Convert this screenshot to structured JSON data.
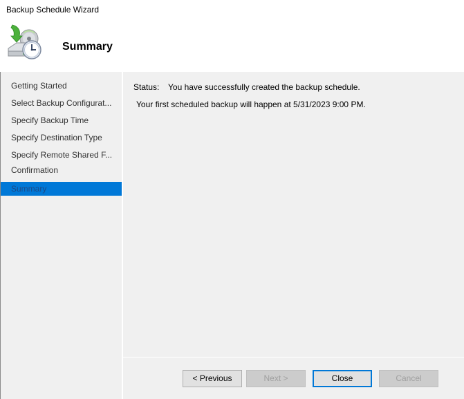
{
  "window": {
    "title": "Backup Schedule Wizard"
  },
  "header": {
    "icon": "backup-schedule-icon",
    "page_title": "Summary"
  },
  "sidebar": {
    "items": [
      {
        "label": "Getting Started",
        "selected": false
      },
      {
        "label": "Select Backup Configurat...",
        "selected": false
      },
      {
        "label": "Specify Backup Time",
        "selected": false
      },
      {
        "label": "Specify Destination Type",
        "selected": false
      },
      {
        "label": "Specify Remote Shared F...",
        "selected": false
      },
      {
        "label": "Confirmation",
        "selected": false
      },
      {
        "label": "Summary",
        "selected": true
      }
    ]
  },
  "main": {
    "status_label": "Status:",
    "status_text": "You have successfully created the backup schedule.",
    "detail_text": "Your first scheduled backup will happen at 5/31/2023 9:00 PM."
  },
  "footer": {
    "previous_label": "< Previous",
    "next_label": "Next >",
    "close_label": "Close",
    "cancel_label": "Cancel"
  },
  "colors": {
    "accent": "#0078d7",
    "panel_bg": "#f0f0f0",
    "header_bg": "#ffffff"
  }
}
